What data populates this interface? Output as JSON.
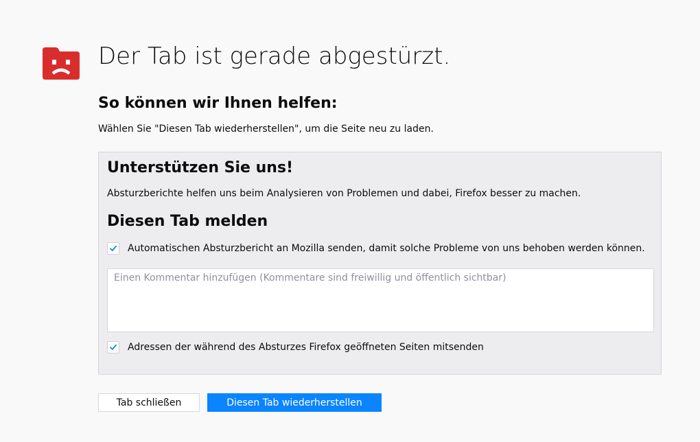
{
  "page": {
    "title": "Der Tab ist gerade abgestürzt.",
    "icon": "sad-tab-icon",
    "accent_color": "#d92d2d"
  },
  "help": {
    "heading": "So können wir Ihnen helfen:",
    "text": "Wählen Sie \"Diesen Tab wiederherstellen\", um die Seite neu zu laden."
  },
  "report": {
    "support_heading": "Unterstützen Sie uns!",
    "support_text": "Absturzberichte helfen uns beim Analysieren von Problemen und dabei, Firefox besser zu machen.",
    "report_heading": "Diesen Tab melden",
    "send_report": {
      "label": "Automatischen Absturzbericht an Mozilla senden, damit solche Probleme von uns behoben werden können.",
      "checked": true
    },
    "comment": {
      "placeholder": "Einen Kommentar hinzufügen (Kommentare sind freiwillig und öffentlich sichtbar)",
      "value": ""
    },
    "include_urls": {
      "label": "Adressen der während des Absturzes Firefox geöffneten Seiten mitsenden",
      "checked": true
    }
  },
  "buttons": {
    "close_label": "Tab schließen",
    "restore_label": "Diesen Tab wiederherstellen",
    "primary_color": "#0a84ff"
  }
}
